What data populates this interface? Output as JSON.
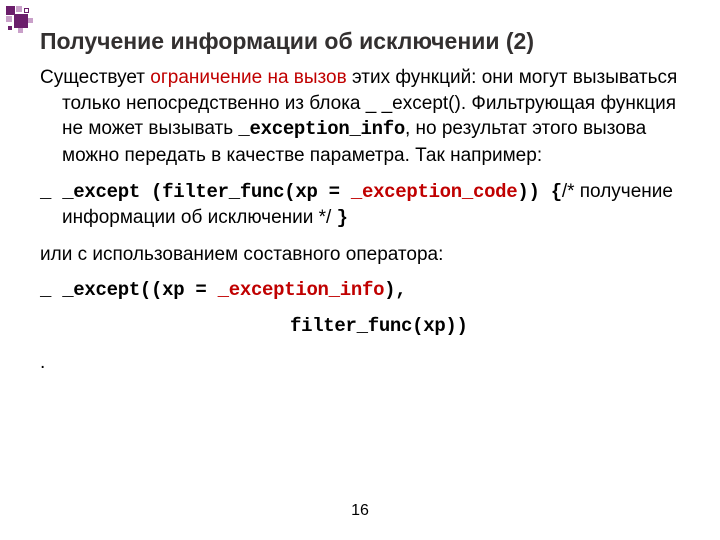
{
  "title": "Получение информации об исключении (2)",
  "para1": {
    "pre": "Существует ",
    "red": "ограничение на вызов",
    "post": " этих функций: они могут вызываться только непосредственно из блока _ _except(). Фильтрующая функция не может вызывать ",
    "code1": "_exception_info",
    "tail": ", но результат этого вызова можно передать в качестве параметра. Так  например:"
  },
  "code_line1": {
    "a": " _ _except (filter_func(xp = ",
    "b": "_exception_code",
    "c": ")) {",
    "comment": "/* получение информации об исключении */ ",
    "d": "}"
  },
  "para2": "или с использованием составного оператора:",
  "code_line2": {
    "a": " _ _except((xp = ",
    "b": "_exception_info",
    "c": "),"
  },
  "code_line3": "filter_func(xp))",
  "dot": ".",
  "page": "16"
}
